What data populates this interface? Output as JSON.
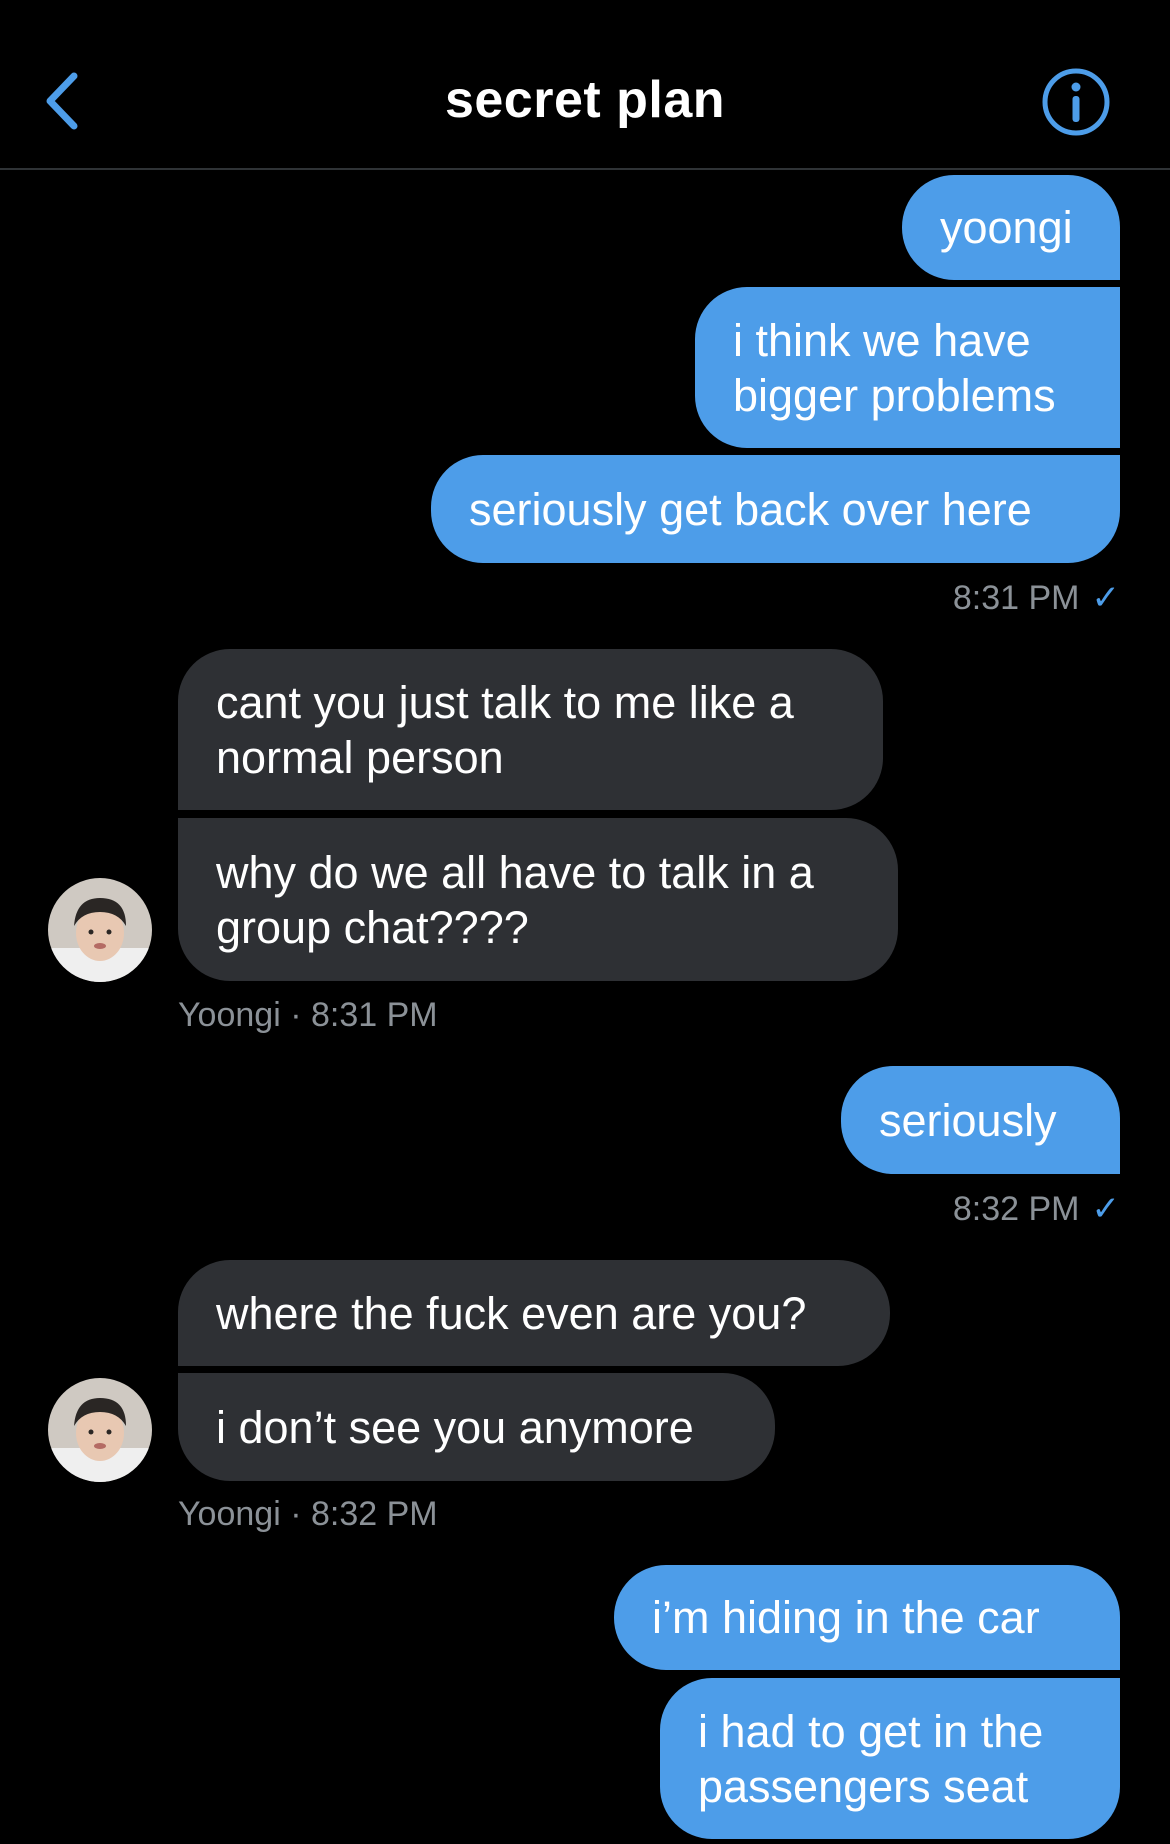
{
  "header": {
    "title": "secret plan",
    "accent_color": "#4d9de9",
    "back_icon": "chevron-left-icon",
    "info_icon": "info-circle-icon"
  },
  "messages": {
    "m1": "yoongi",
    "m2": "i think we have\nbigger problems",
    "m3": "seriously get back over here",
    "meta1_time": "8:31 PM",
    "meta1_check": "✓",
    "m4": "cant you just talk to me like a\nnormal person",
    "m5": "why do we all have to talk in a\ngroup chat????",
    "meta2": "Yoongi · 8:31 PM",
    "m6": "seriously",
    "meta3_time": "8:32 PM",
    "meta3_check": "✓",
    "m7": "where the fuck even are you?",
    "m8": "i don’t see you anymore",
    "meta4": "Yoongi · 8:32 PM",
    "m9": "i’m hiding in the car",
    "m10": "i had to get in the\npassengers seat"
  },
  "colors": {
    "outgoing_bubble": "#4d9de9",
    "incoming_bubble": "#2e3034",
    "meta_text": "#8b9197",
    "background": "#000000"
  }
}
